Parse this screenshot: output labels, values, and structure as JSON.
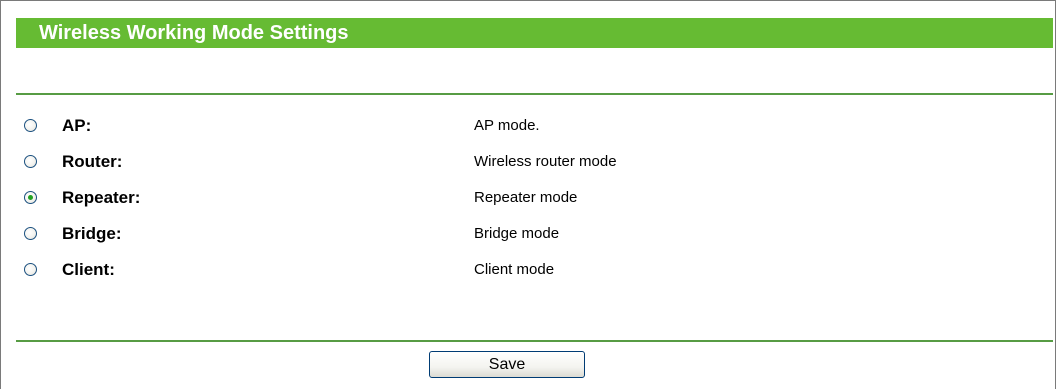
{
  "header": {
    "title": "Wireless Working Mode Settings"
  },
  "modes": [
    {
      "name": "AP:",
      "description": "AP mode.",
      "selected": false
    },
    {
      "name": "Router:",
      "description": "Wireless router mode",
      "selected": false
    },
    {
      "name": "Repeater:",
      "description": "Repeater mode",
      "selected": true
    },
    {
      "name": "Bridge:",
      "description": "Bridge mode",
      "selected": false
    },
    {
      "name": "Client:",
      "description": "Client mode",
      "selected": false
    }
  ],
  "actions": {
    "save_label": "Save"
  },
  "colors": {
    "header_bg": "#66bb33",
    "rule": "#579c44",
    "radio_dot": "#21a121",
    "button_border": "#003c74"
  }
}
